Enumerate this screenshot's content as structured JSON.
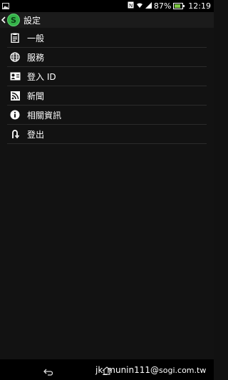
{
  "status_bar": {
    "signal": "87%",
    "time": "12:19",
    "icons": [
      "image-icon",
      "nfc-icon",
      "wifi-icon",
      "signal-icon",
      "battery-icon"
    ]
  },
  "action_bar": {
    "title": "設定",
    "app_icon_letter": "S",
    "accent": "#35b34a"
  },
  "menu": {
    "items": [
      {
        "label": "一般",
        "icon": "clipboard-icon"
      },
      {
        "label": "服務",
        "icon": "globe-icon"
      },
      {
        "label": "登入 ID",
        "icon": "id-card-icon"
      },
      {
        "label": "新聞",
        "icon": "rss-icon"
      },
      {
        "label": "相關資訊",
        "icon": "info-icon"
      },
      {
        "label": "登出",
        "icon": "logout-icon"
      }
    ]
  },
  "nav_bar": {
    "watermark_user": "jk_munin111@",
    "watermark_site": "sogi.com.tw"
  }
}
